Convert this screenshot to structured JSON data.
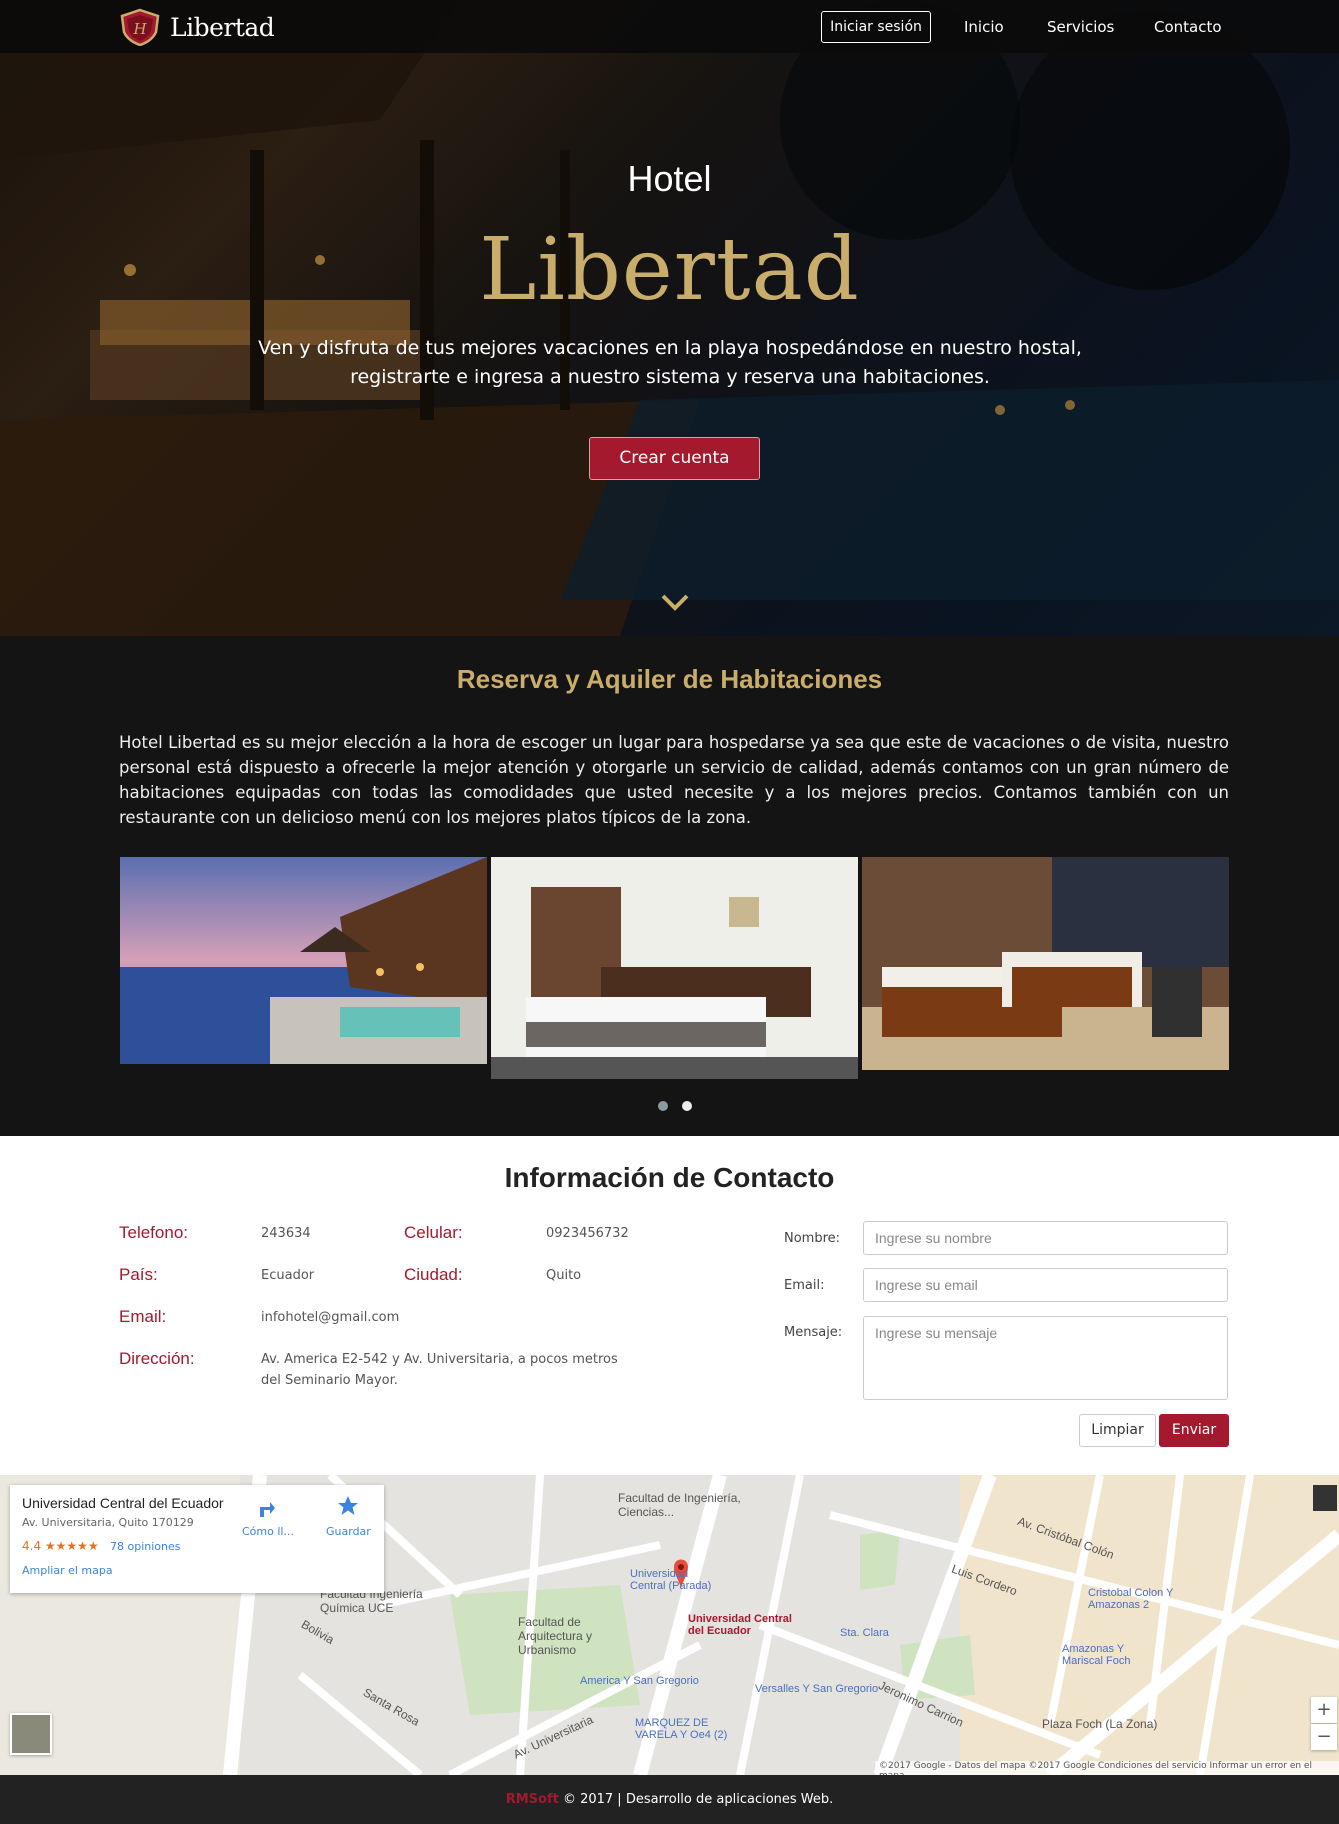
{
  "nav": {
    "brand": "Libertad",
    "login_label": "Iniciar sesión",
    "links": [
      "Inicio",
      "Servicios",
      "Contacto"
    ]
  },
  "hero": {
    "title_small": "Hotel",
    "title_large": "Libertad",
    "text": "Ven y disfruta de tus mejores vacaciones en la playa hospedándose en nuestro hostal, registrarte e ingresa a nuestro sistema y reserva una habitaciones.",
    "cta_label": "Crear cuenta"
  },
  "reserva": {
    "title": "Reserva y Aquiler de Habitaciones",
    "text": "Hotel Libertad es su mejor elección a la hora de escoger un lugar para hospedarse ya sea que este de vacaciones o de visita, nuestro personal está dispuesto a ofrecerle la mejor atención y otorgarle un servicio de calidad, además contamos con un gran número de habitaciones equipadas con todas las comodidades que usted necesite y a los mejores precios. Contamos también con un restaurante con un delicioso menú con los mejores platos típicos de la zona."
  },
  "contact": {
    "title": "Información de Contacto",
    "telefono_label": "Telefono:",
    "telefono": "243634",
    "celular_label": "Celular:",
    "celular": "0923456732",
    "pais_label": "País:",
    "pais": "Ecuador",
    "ciudad_label": "Ciudad:",
    "ciudad": "Quito",
    "email_label": "Email:",
    "email": "infohotel@gmail.com",
    "direccion_label": "Dirección:",
    "direccion": "Av. America E2-542 y Av. Universitaria, a pocos metros del Seminario Mayor."
  },
  "form": {
    "nombre_label": "Nombre:",
    "nombre_placeholder": "Ingrese su nombre",
    "email_label": "Email:",
    "email_placeholder": "Ingrese su email",
    "mensaje_label": "Mensaje:",
    "mensaje_placeholder": "Ingrese su mensaje",
    "clear_label": "Limpiar",
    "send_label": "Enviar"
  },
  "map": {
    "place_title": "Universidad Central del Ecuador",
    "place_address": "Av. Universitaria, Quito 170129",
    "rating": "4.4 ★★★★★",
    "reviews": "78 opiniones",
    "enlarge_link": "Ampliar el mapa",
    "directions_label": "Cómo ll...",
    "save_label": "Guardar",
    "marker_label": "Universidad Central del Ecuador",
    "labels": [
      "Facultad de Ingeniería, Ciencias...",
      "Facultad Ingeniería Química UCE",
      "Facultad de Arquitectura y Urbanismo",
      "Plaza Foch (La Zona)",
      "Av. Cristóbal Colón",
      "Luis Cordero",
      "Jeronimo Carrion",
      "Santa Rosa",
      "Av. Universitaria",
      "Bolivia"
    ],
    "blue_labels": [
      "Universidad Central (Parada)",
      "America Y San Gregorio",
      "Versalles Y San Gregorio",
      "Sta. Clara",
      "Cristobal Colon Y Amazonas 2",
      "Amazonas Y Mariscal Foch",
      "MARQUEZ DE VARELA Y Oe4 (2)"
    ],
    "attribution": "©2017 Google - Datos del mapa ©2017 Google   Condiciones del servicio   Informar un error en el mapa",
    "zoom_in": "+",
    "zoom_out": "−"
  },
  "footer": {
    "brand": "RMSoft",
    "text": " © 2017 | Desarrollo de aplicaciones Web."
  },
  "colors": {
    "accent": "#a4192d",
    "gold": "#c9ad6a",
    "dark": "#141414"
  }
}
